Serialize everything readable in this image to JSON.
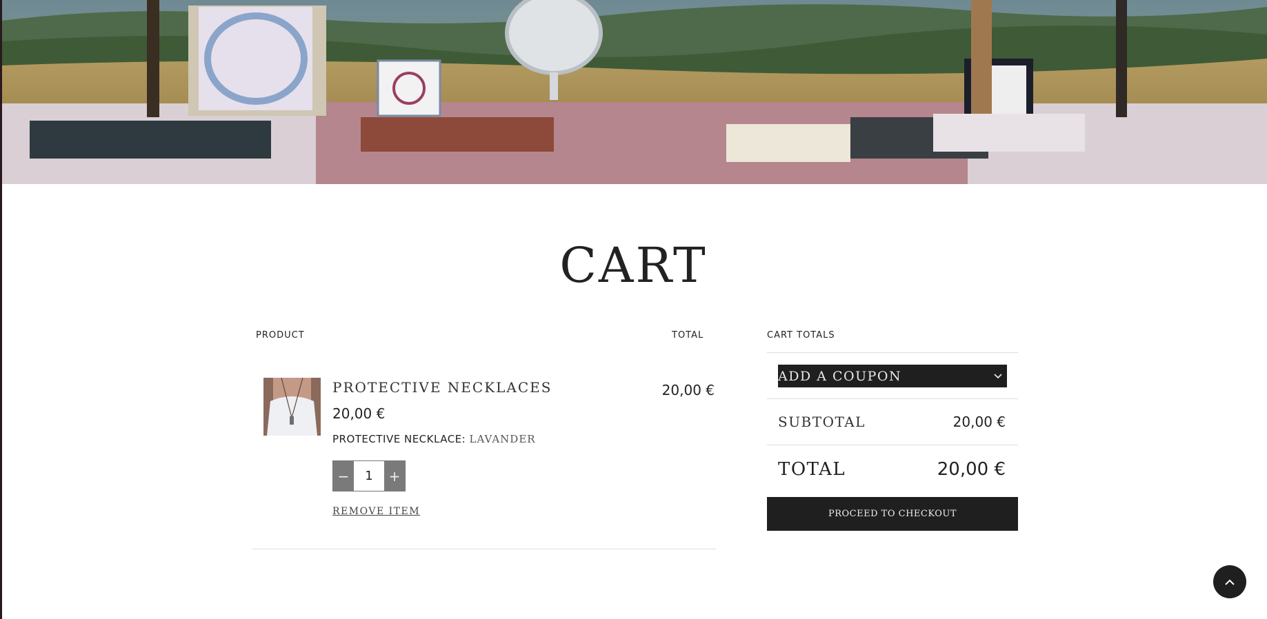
{
  "page": {
    "title": "CART"
  },
  "hero": {
    "icon": "market-stall-photo"
  },
  "cart": {
    "columns": {
      "product": "PRODUCT",
      "total": "TOTAL"
    },
    "item": {
      "name": "PROTECTIVE NECKLACES",
      "price": "20,00 €",
      "variation_label": "PROTECTIVE NECKLACE:",
      "variation_value": "LAVANDER",
      "quantity": "1",
      "decrease_icon": "minus-icon",
      "increase_icon": "plus-icon",
      "remove_label": "REMOVE ITEM",
      "line_total": "20,00 €",
      "thumbnail_icon": "necklace-photo"
    }
  },
  "totals": {
    "heading": "CART TOTALS",
    "coupon_label": "ADD A COUPON",
    "coupon_icon": "chevron-down-icon",
    "subtotal_label": "SUBTOTAL",
    "subtotal_value": "20,00 €",
    "total_label": "TOTAL",
    "total_value": "20,00 €",
    "checkout_label": "PROCEED TO CHECKOUT"
  },
  "scroll_top": {
    "icon": "chevron-up-icon"
  },
  "colors": {
    "dark": "#1f1f1f",
    "divider": "#dddddd",
    "stepper": "#7a7a7a"
  }
}
